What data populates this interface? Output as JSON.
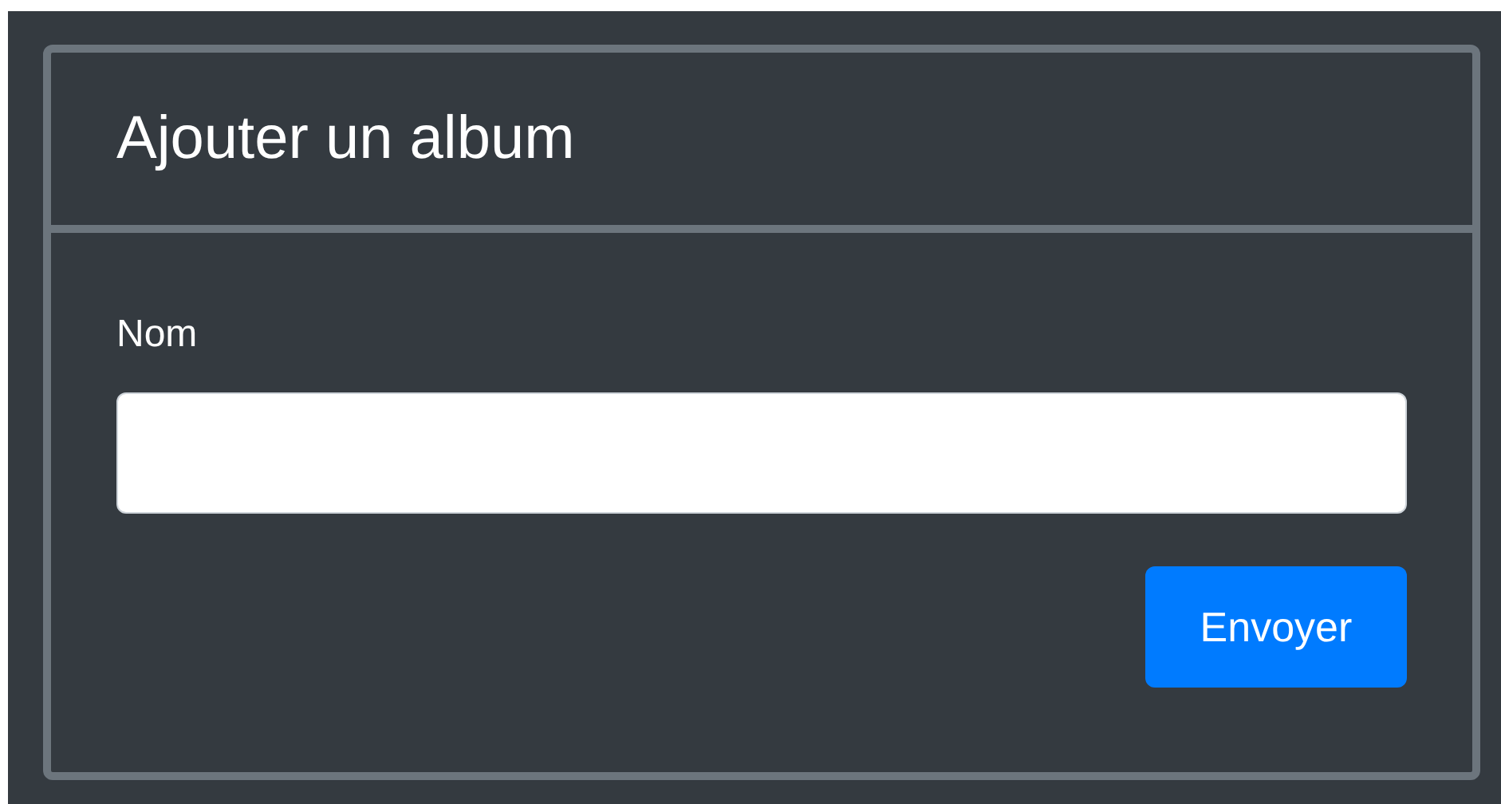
{
  "card": {
    "title": "Ajouter un album"
  },
  "form": {
    "fields": [
      {
        "label": "Nom"
      }
    ],
    "submit": "Envoyer"
  }
}
